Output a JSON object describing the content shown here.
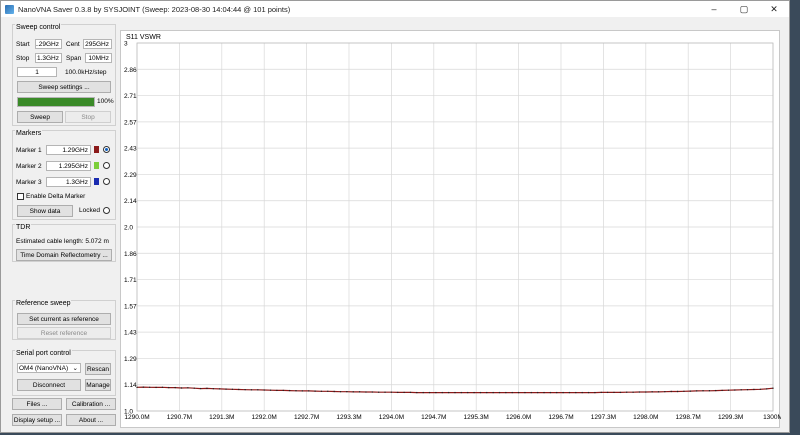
{
  "window": {
    "title": "NanoVNA Saver 0.3.8 by SYSJOINT (Sweep: 2023-08-30 14:04:44 @ 101 points)",
    "controls": [
      "–",
      "▢",
      "✕"
    ]
  },
  "sweep_control": {
    "title": "Sweep control",
    "start_label": "Start",
    "start_value": "1.29GHz",
    "center_label": "Cent",
    "center_value": "295GHz",
    "stop_label": "Stop",
    "stop_value": "1.3GHz",
    "span_label": "Span",
    "span_value": "10MHz",
    "segments_value": "1",
    "step_text": "100.0kHz/step",
    "settings_button": "Sweep settings ...",
    "progress_percent": 100,
    "progress_text": "100%",
    "sweep_button": "Sweep",
    "stop_button": "Stop"
  },
  "markers": {
    "title": "Markers",
    "items": [
      {
        "label": "Marker 1",
        "value": "1.29GHz",
        "color": "#8b1a1a",
        "selected": true
      },
      {
        "label": "Marker 2",
        "value": "1.295GHz",
        "color": "#7ccf3a",
        "selected": false
      },
      {
        "label": "Marker 3",
        "value": "1.3GHz",
        "color": "#1a2bb0",
        "selected": false
      }
    ],
    "delta_label": "Enable Delta Marker",
    "show_data_button": "Show data",
    "locked_label": "Locked"
  },
  "tdr": {
    "title": "TDR",
    "cable_text": "Estimated cable length: 5.072 m",
    "tdr_button": "Time Domain Reflectometry ..."
  },
  "reference": {
    "title": "Reference sweep",
    "set_button": "Set current as reference",
    "reset_button": "Reset reference"
  },
  "serial": {
    "title": "Serial port control",
    "port_value": "OM4 (NanoVNA)",
    "rescan_button": "Rescan",
    "disconnect_button": "Disconnect",
    "manage_button": "Manage"
  },
  "bottom_buttons": {
    "files": "Files ...",
    "calibration": "Calibration ...",
    "display_setup": "Display setup ...",
    "about": "About ..."
  },
  "chart_data": {
    "type": "line",
    "title": "S11 VSWR",
    "x_tick_labels": [
      "1290.0M",
      "1290.7M",
      "1291.3M",
      "1292.0M",
      "1292.7M",
      "1293.3M",
      "1294.0M",
      "1294.7M",
      "1295.3M",
      "1296.0M",
      "1296.7M",
      "1297.3M",
      "1298.0M",
      "1298.7M",
      "1299.3M",
      "1300M"
    ],
    "y_tick_labels": [
      "3",
      "2.86",
      "2.71",
      "2.57",
      "2.43",
      "2.29",
      "2.14",
      "2.0",
      "1.86",
      "1.71",
      "1.57",
      "1.43",
      "1.29",
      "1.14",
      "1.0"
    ],
    "xlim": [
      1290.0,
      1300.0
    ],
    "ylim": [
      1.0,
      3.0
    ],
    "grid": true,
    "line_color": "#8b1a1a",
    "series": [
      {
        "x": [
          1290.0,
          1290.1,
          1290.2,
          1290.3,
          1290.4,
          1290.5,
          1290.6,
          1290.7,
          1290.8,
          1290.9,
          1291.0,
          1291.1,
          1291.2,
          1291.3,
          1291.4,
          1291.5,
          1291.6,
          1291.7,
          1291.8,
          1291.9,
          1292.0,
          1292.1,
          1292.2,
          1292.3,
          1292.4,
          1292.5,
          1292.6,
          1292.7,
          1292.8,
          1292.9,
          1293.0,
          1293.1,
          1293.2,
          1293.3,
          1293.4,
          1293.5,
          1293.6,
          1293.7,
          1293.8,
          1293.9,
          1294.0,
          1294.1,
          1294.2,
          1294.3,
          1294.4,
          1294.5,
          1294.6,
          1294.7,
          1294.8,
          1294.9,
          1295.0,
          1295.1,
          1295.2,
          1295.3,
          1295.4,
          1295.5,
          1295.6,
          1295.7,
          1295.8,
          1295.9,
          1296.0,
          1296.1,
          1296.2,
          1296.3,
          1296.4,
          1296.5,
          1296.6,
          1296.7,
          1296.8,
          1296.9,
          1297.0,
          1297.1,
          1297.2,
          1297.3,
          1297.4,
          1297.5,
          1297.6,
          1297.7,
          1297.8,
          1297.9,
          1298.0,
          1298.1,
          1298.2,
          1298.3,
          1298.4,
          1298.5,
          1298.6,
          1298.7,
          1298.8,
          1298.9,
          1299.0,
          1299.1,
          1299.2,
          1299.3,
          1299.4,
          1299.5,
          1299.6,
          1299.7,
          1299.8,
          1299.9,
          1300.0
        ],
        "y": [
          1.129,
          1.13,
          1.129,
          1.128,
          1.129,
          1.127,
          1.127,
          1.125,
          1.126,
          1.124,
          1.122,
          1.123,
          1.121,
          1.12,
          1.119,
          1.118,
          1.117,
          1.116,
          1.115,
          1.115,
          1.114,
          1.113,
          1.112,
          1.112,
          1.111,
          1.11,
          1.109,
          1.109,
          1.108,
          1.107,
          1.107,
          1.106,
          1.105,
          1.105,
          1.104,
          1.104,
          1.103,
          1.103,
          1.102,
          1.102,
          1.102,
          1.101,
          1.101,
          1.101,
          1.1,
          1.1,
          1.1,
          1.1,
          1.1,
          1.1,
          1.1,
          1.1,
          1.1,
          1.1,
          1.1,
          1.1,
          1.1,
          1.1,
          1.1,
          1.1,
          1.1,
          1.1,
          1.1,
          1.1,
          1.1,
          1.1,
          1.1,
          1.1,
          1.1,
          1.1,
          1.1,
          1.1,
          1.1,
          1.101,
          1.101,
          1.101,
          1.101,
          1.102,
          1.102,
          1.103,
          1.103,
          1.104,
          1.104,
          1.105,
          1.106,
          1.106,
          1.107,
          1.108,
          1.109,
          1.11,
          1.11,
          1.111,
          1.112,
          1.113,
          1.114,
          1.115,
          1.116,
          1.117,
          1.118,
          1.12,
          1.124
        ]
      }
    ]
  }
}
